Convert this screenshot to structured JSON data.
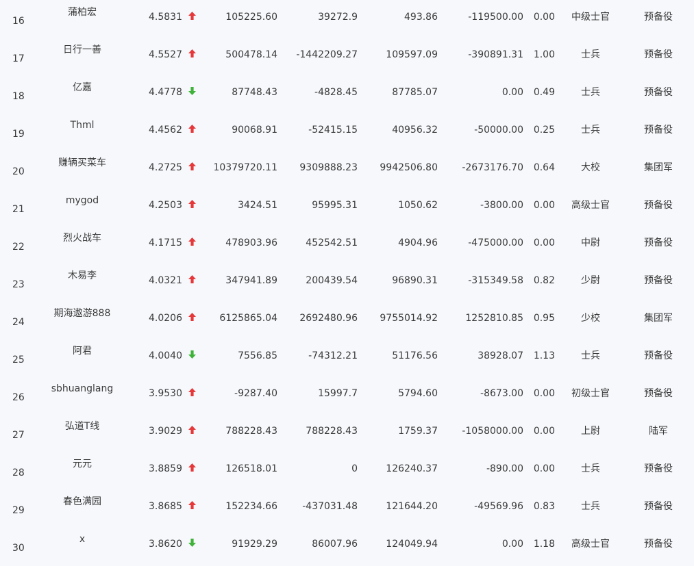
{
  "rows": [
    {
      "rank": "16",
      "name": "蒲柏宏",
      "score": "4.5831",
      "trend": "up",
      "v1": "105225.60",
      "v2": "39272.9",
      "v3": "493.86",
      "v4": "-119500.00",
      "ratio": "0.00",
      "rank_name": "中级士官",
      "army": "预备役"
    },
    {
      "rank": "17",
      "name": "日行一善",
      "score": "4.5527",
      "trend": "up",
      "v1": "500478.14",
      "v2": "-1442209.27",
      "v3": "109597.09",
      "v4": "-390891.31",
      "ratio": "1.00",
      "rank_name": "士兵",
      "army": "预备役"
    },
    {
      "rank": "18",
      "name": "亿嘉",
      "score": "4.4778",
      "trend": "down",
      "v1": "87748.43",
      "v2": "-4828.45",
      "v3": "87785.07",
      "v4": "0.00",
      "ratio": "0.49",
      "rank_name": "士兵",
      "army": "预备役"
    },
    {
      "rank": "19",
      "name": "Thml",
      "score": "4.4562",
      "trend": "up",
      "v1": "90068.91",
      "v2": "-52415.15",
      "v3": "40956.32",
      "v4": "-50000.00",
      "ratio": "0.25",
      "rank_name": "士兵",
      "army": "预备役"
    },
    {
      "rank": "20",
      "name": "赚辆买菜车",
      "score": "4.2725",
      "trend": "up",
      "v1": "10379720.11",
      "v2": "9309888.23",
      "v3": "9942506.80",
      "v4": "-2673176.70",
      "ratio": "0.64",
      "rank_name": "大校",
      "army": "集团军"
    },
    {
      "rank": "21",
      "name": "mygod",
      "score": "4.2503",
      "trend": "up",
      "v1": "3424.51",
      "v2": "95995.31",
      "v3": "1050.62",
      "v4": "-3800.00",
      "ratio": "0.00",
      "rank_name": "高级士官",
      "army": "预备役"
    },
    {
      "rank": "22",
      "name": "烈火战车",
      "score": "4.1715",
      "trend": "up",
      "v1": "478903.96",
      "v2": "452542.51",
      "v3": "4904.96",
      "v4": "-475000.00",
      "ratio": "0.00",
      "rank_name": "中尉",
      "army": "预备役"
    },
    {
      "rank": "23",
      "name": "木易李",
      "score": "4.0321",
      "trend": "up",
      "v1": "347941.89",
      "v2": "200439.54",
      "v3": "96890.31",
      "v4": "-315349.58",
      "ratio": "0.82",
      "rank_name": "少尉",
      "army": "预备役"
    },
    {
      "rank": "24",
      "name": "期海遨游888",
      "score": "4.0206",
      "trend": "up",
      "v1": "6125865.04",
      "v2": "2692480.96",
      "v3": "9755014.92",
      "v4": "1252810.85",
      "ratio": "0.95",
      "rank_name": "少校",
      "army": "集团军"
    },
    {
      "rank": "25",
      "name": "阿君",
      "score": "4.0040",
      "trend": "down",
      "v1": "7556.85",
      "v2": "-74312.21",
      "v3": "51176.56",
      "v4": "38928.07",
      "ratio": "1.13",
      "rank_name": "士兵",
      "army": "预备役"
    },
    {
      "rank": "26",
      "name": "sbhuanglang",
      "score": "3.9530",
      "trend": "up",
      "v1": "-9287.40",
      "v2": "15997.7",
      "v3": "5794.60",
      "v4": "-8673.00",
      "ratio": "0.00",
      "rank_name": "初级士官",
      "army": "预备役"
    },
    {
      "rank": "27",
      "name": "弘道T线",
      "score": "3.9029",
      "trend": "up",
      "v1": "788228.43",
      "v2": "788228.43",
      "v3": "1759.37",
      "v4": "-1058000.00",
      "ratio": "0.00",
      "rank_name": "上尉",
      "army": "陆军"
    },
    {
      "rank": "28",
      "name": "元元",
      "score": "3.8859",
      "trend": "up",
      "v1": "126518.01",
      "v2": "0",
      "v3": "126240.37",
      "v4": "-890.00",
      "ratio": "0.00",
      "rank_name": "士兵",
      "army": "预备役"
    },
    {
      "rank": "29",
      "name": "春色满园",
      "score": "3.8685",
      "trend": "up",
      "v1": "152234.66",
      "v2": "-437031.48",
      "v3": "121644.20",
      "v4": "-49569.96",
      "ratio": "0.83",
      "rank_name": "士兵",
      "army": "预备役"
    },
    {
      "rank": "30",
      "name": "x",
      "score": "3.8620",
      "trend": "down",
      "v1": "91929.29",
      "v2": "86007.96",
      "v3": "124049.94",
      "v4": "0.00",
      "ratio": "1.18",
      "rank_name": "高级士官",
      "army": "预备役"
    }
  ],
  "colors": {
    "up": "#e5383b",
    "down": "#3fb23a",
    "text": "#3b3b3b",
    "background": "#f6f8fb"
  }
}
